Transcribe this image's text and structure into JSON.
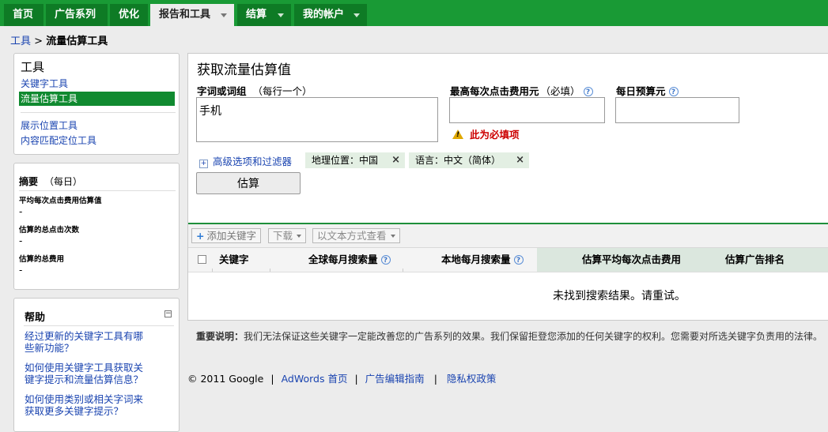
{
  "nav": {
    "tabs": [
      {
        "label": "首页",
        "dropdown": false,
        "active": false
      },
      {
        "label": "广告系列",
        "dropdown": false,
        "active": false
      },
      {
        "label": "优化",
        "dropdown": false,
        "active": false
      },
      {
        "label": "报告和工具",
        "dropdown": true,
        "active": true
      },
      {
        "label": "结算",
        "dropdown": true,
        "active": false
      },
      {
        "label": "我的帐户",
        "dropdown": true,
        "active": false
      }
    ]
  },
  "breadcrumb": {
    "root": "工具",
    "separator": ">",
    "current": "流量估算工具"
  },
  "sidebar": {
    "tools_title": "工具",
    "links": [
      "关键字工具",
      "流量估算工具",
      "展示位置工具",
      "内容匹配定位工具"
    ],
    "selected": "流量估算工具"
  },
  "summary": {
    "title": "摘要",
    "period": "（每日）",
    "items": [
      {
        "label": "平均每次点击费用估算值",
        "value": "-"
      },
      {
        "label": "估算的总点击次数",
        "value": "-"
      },
      {
        "label": "估算的总费用",
        "value": "-"
      }
    ]
  },
  "help": {
    "title": "帮助",
    "collapse": "−",
    "links": [
      "经过更新的关键字工具有哪些新功能？",
      "如何使用关键字工具获取关键字提示和流量估算信息？",
      "如何使用类别或相关字词来获取更多关键字提示？"
    ]
  },
  "main": {
    "title": "获取流量估算值",
    "keywords_label": "字词或词组",
    "keywords_note": "（每行一个）",
    "keywords_value": "手机",
    "max_cpc_label": "最高每次点击费用元",
    "max_cpc_note": "（必填）",
    "daily_budget_label": "每日预算元",
    "help_glyph": "?",
    "required_msg": "此为必填项",
    "warn_glyph": "!",
    "advanced_label": "高级选项和过滤器",
    "advanced_glyph": "+",
    "chips": [
      {
        "label": "地理位置：中国",
        "remove": "×"
      },
      {
        "label": "语言：中文（简体）",
        "remove": "×"
      }
    ],
    "estimate_button": "估算"
  },
  "results": {
    "toolbar": {
      "add": "添加关键字",
      "add_glyph": "+",
      "download": "下载",
      "view_text": "以文本方式查看"
    },
    "columns": [
      "关键字",
      "全球每月搜索量",
      "本地每月搜索量",
      "估算平均每次点击费用",
      "估算广告排名"
    ],
    "empty_message": "未找到搜索结果。请重试。"
  },
  "notice": {
    "label": "重要说明：",
    "text": "我们无法保证这些关键字一定能改善您的广告系列的效果。我们保留拒登您添加的任何关键字的权利。您需要对所选关键字负责用的法律。"
  },
  "footer": {
    "copyright": "© 2011 Google",
    "sep": "|",
    "links": [
      "AdWords 首页",
      "广告编辑指南",
      "隐私权政策"
    ]
  },
  "colors": {
    "nav_green": "#199a35",
    "tab_green": "#0e7b25",
    "selected_green": "#108a30",
    "link_blue": "#1a44b0",
    "required_red": "#cc0000"
  }
}
